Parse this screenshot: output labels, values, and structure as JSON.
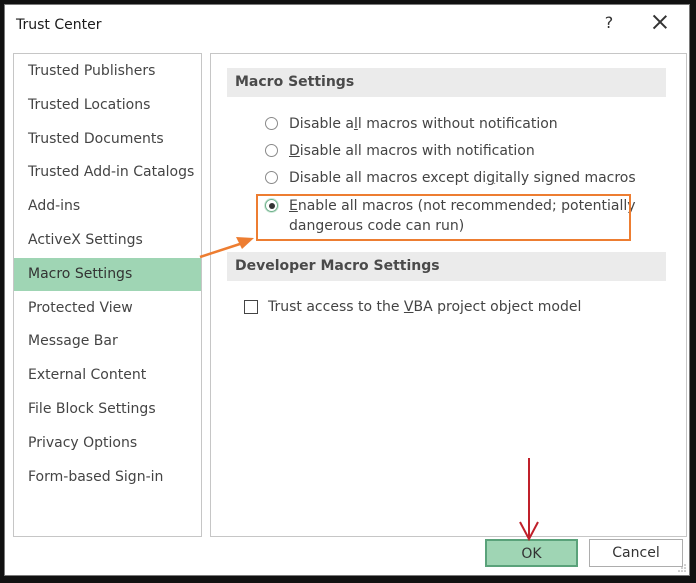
{
  "window": {
    "title": "Trust Center",
    "help_label": "?",
    "close_icon": "close-icon"
  },
  "sidebar": {
    "items": [
      {
        "label": "Trusted Publishers",
        "active": false
      },
      {
        "label": "Trusted Locations",
        "active": false
      },
      {
        "label": "Trusted Documents",
        "active": false
      },
      {
        "label": "Trusted Add-in Catalogs",
        "active": false
      },
      {
        "label": "Add-ins",
        "active": false
      },
      {
        "label": "ActiveX Settings",
        "active": false
      },
      {
        "label": "Macro Settings",
        "active": true
      },
      {
        "label": "Protected View",
        "active": false
      },
      {
        "label": "Message Bar",
        "active": false
      },
      {
        "label": "External Content",
        "active": false
      },
      {
        "label": "File Block Settings",
        "active": false
      },
      {
        "label": "Privacy Options",
        "active": false
      },
      {
        "label": "Form-based Sign-in",
        "active": false
      }
    ]
  },
  "macro_settings": {
    "heading": "Macro Settings",
    "options": [
      {
        "pre": "Disable a",
        "accel": "l",
        "post": "l macros without notification",
        "line2": "",
        "checked": false
      },
      {
        "pre": "",
        "accel": "D",
        "post": "isable all macros with notification",
        "line2": "",
        "checked": false
      },
      {
        "pre": "Disable all macros except di",
        "accel": "g",
        "post": "itally signed macros",
        "line2": "",
        "checked": false
      },
      {
        "pre": "",
        "accel": "E",
        "post": "nable all macros (not recommended; potentially",
        "line2": "dangerous code can run)",
        "checked": true
      }
    ]
  },
  "developer_settings": {
    "heading": "Developer Macro Settings",
    "checkbox": {
      "pre": "Trust access to the ",
      "accel": "V",
      "post": "BA project object model",
      "checked": false
    }
  },
  "buttons": {
    "ok": "OK",
    "cancel": "Cancel"
  },
  "annotations": {
    "highlight_color": "#ed7d31",
    "arrow_color": "#ed7d31",
    "ok_arrow_color": "#c0202a"
  }
}
